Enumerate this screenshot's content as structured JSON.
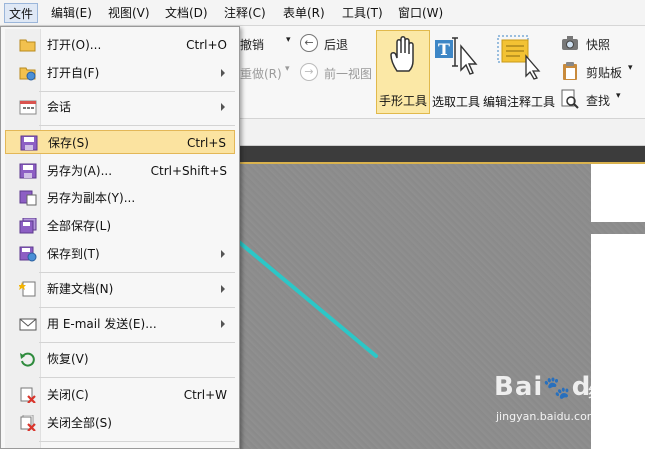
{
  "menubar": {
    "items": [
      "文件",
      "编辑(E)",
      "视图(V)",
      "文档(D)",
      "注释(C)",
      "表单(R)",
      "工具(T)",
      "窗口(W)"
    ]
  },
  "ribbon": {
    "undo": "撤销",
    "back": "后退",
    "redo": "重做(R)",
    "prev_view": "前一视图",
    "hand_tool": "手形工具",
    "select_tool": "选取工具",
    "annot_tool": "编辑注释工具",
    "snapshot": "快照",
    "clipboard": "剪贴板",
    "find": "查找"
  },
  "file_menu": {
    "items": [
      {
        "label": "打开(O)...",
        "shortcut": "Ctrl+O",
        "submenu": false
      },
      {
        "label": "打开自(F)",
        "shortcut": "",
        "submenu": true
      },
      {
        "label": "会话",
        "shortcut": "",
        "submenu": true
      },
      {
        "label": "保存(S)",
        "shortcut": "Ctrl+S",
        "submenu": false,
        "highlighted": true
      },
      {
        "label": "另存为(A)...",
        "shortcut": "Ctrl+Shift+S",
        "submenu": false
      },
      {
        "label": "另存为副本(Y)...",
        "shortcut": "",
        "submenu": false
      },
      {
        "label": "全部保存(L)",
        "shortcut": "",
        "submenu": false
      },
      {
        "label": "保存到(T)",
        "shortcut": "",
        "submenu": true
      },
      {
        "label": "新建文档(N)",
        "shortcut": "",
        "submenu": true
      },
      {
        "label": "用 E-mail 发送(E)...",
        "shortcut": "",
        "submenu": true
      },
      {
        "label": "恢复(V)",
        "shortcut": "",
        "submenu": false
      },
      {
        "label": "关闭(C)",
        "shortcut": "Ctrl+W",
        "submenu": false
      },
      {
        "label": "关闭全部(S)",
        "shortcut": "",
        "submenu": false
      }
    ]
  },
  "watermark": {
    "brand": "Bai",
    "brand2": "du",
    "suffix": "经验",
    "url": "jingyan.baidu.com"
  },
  "colors": {
    "highlight": "#fbe3a0",
    "arrow": "#2cc7c7",
    "accent_strip": "#d9b24e"
  }
}
